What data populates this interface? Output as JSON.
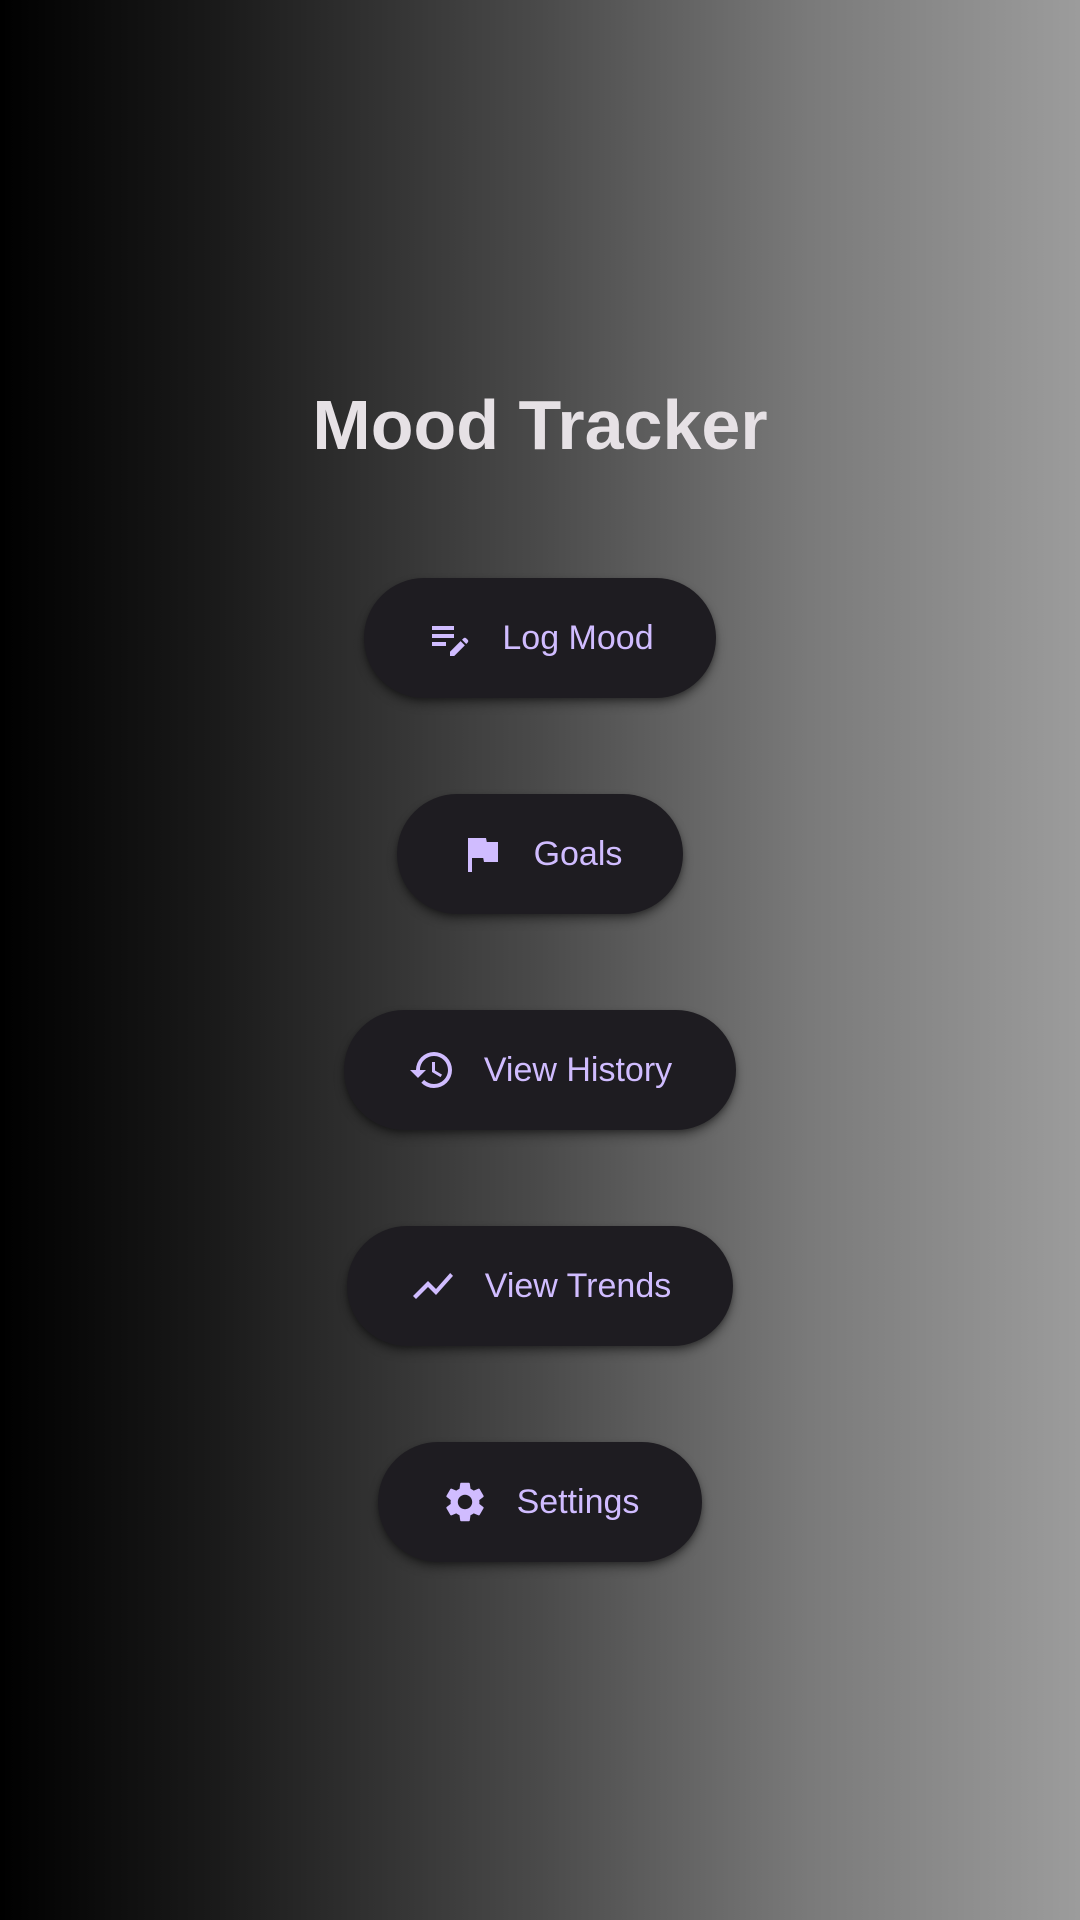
{
  "app": {
    "title": "Mood Tracker"
  },
  "menu": {
    "log_mood": {
      "label": "Log Mood",
      "icon": "edit-note-icon"
    },
    "goals": {
      "label": "Goals",
      "icon": "flag-icon"
    },
    "view_history": {
      "label": "View History",
      "icon": "history-icon"
    },
    "view_trends": {
      "label": "View Trends",
      "icon": "trending-up-icon"
    },
    "settings": {
      "label": "Settings",
      "icon": "gear-icon"
    }
  },
  "colors": {
    "accent": "#d0bcff",
    "button_background": "#1e1c21",
    "title_text": "#e6e1e5"
  }
}
